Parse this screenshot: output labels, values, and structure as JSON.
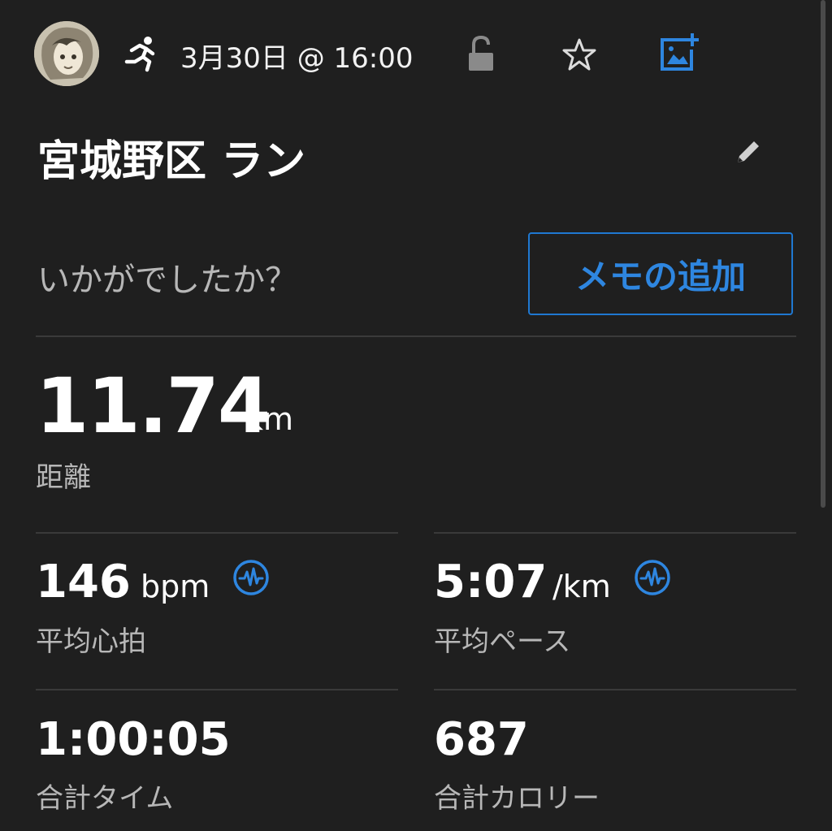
{
  "header": {
    "date_time": "3月30日 @ 16:00",
    "activity_icon": "running-person-icon",
    "privacy_icon": "unlocked-padlock-icon",
    "favorite_icon": "star-outline-icon",
    "add_photo_icon": "add-photo-icon"
  },
  "activity": {
    "title": "宮城野区 ラン",
    "edit_icon": "pencil-icon"
  },
  "feedback": {
    "prompt": "いかがでしたか？",
    "add_memo_label": "メモの追加"
  },
  "distance": {
    "value": "11.74",
    "unit": "km",
    "label": "距離"
  },
  "stats": {
    "heart_rate": {
      "value": "146",
      "unit": "bpm",
      "label": "平均心拍",
      "icon": "heart-rate-wave-icon"
    },
    "pace": {
      "value": "5:07",
      "unit": "/km",
      "label": "平均ペース",
      "icon": "heart-rate-wave-icon"
    },
    "time": {
      "value": "1:00:05",
      "label": "合計タイム"
    },
    "calories": {
      "value": "687",
      "label": "合計カロリー"
    }
  },
  "colors": {
    "background": "#1f1f1f",
    "accent": "#2e86e0",
    "secondary_text": "#b7b7b7",
    "divider": "#3a3a3a"
  }
}
